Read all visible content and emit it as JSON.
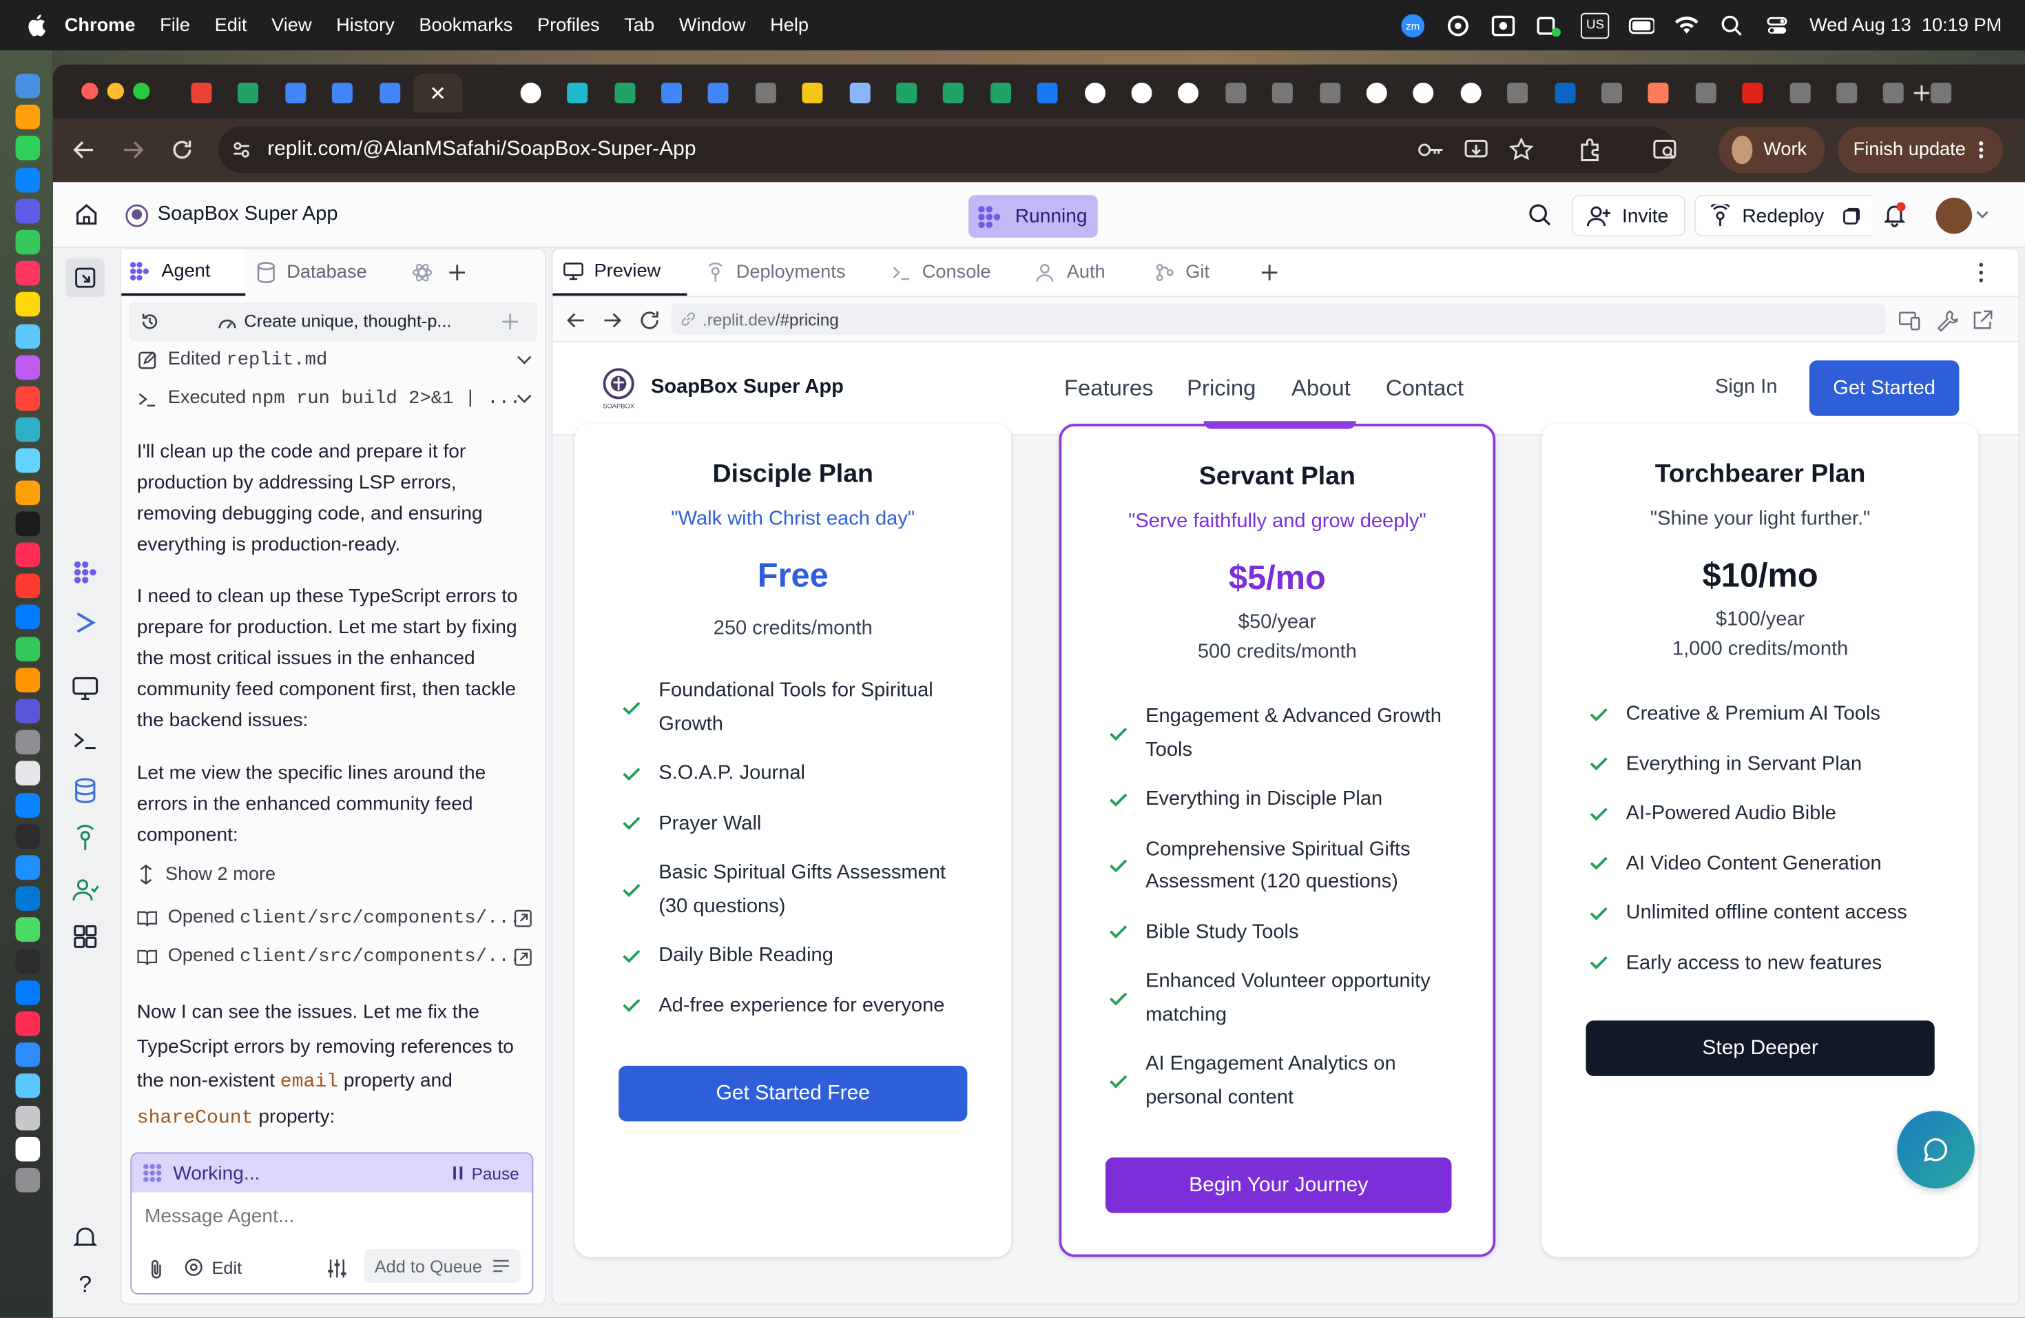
{
  "menubar": {
    "app": "Chrome",
    "menus": [
      "File",
      "Edit",
      "View",
      "History",
      "Bookmarks",
      "Profiles",
      "Tab",
      "Window",
      "Help"
    ],
    "input_source": "US",
    "datetime": "Wed Aug 13  10:19 PM"
  },
  "browser": {
    "url": "replit.com/@AlanMSafahi/SoapBox-Super-App",
    "profile_label": "Work",
    "update_label": "Finish update",
    "tab_icons": [
      "gmail-icon",
      "sheets-icon",
      "docs-icon",
      "docs-icon",
      "docs-icon",
      "replit-icon",
      "chatgpt-icon",
      "perplexity-icon",
      "sheets-icon",
      "docs-icon",
      "docs-icon",
      "app-icon",
      "coin-icon",
      "gemini-icon",
      "sheets-icon",
      "sheets-icon",
      "sheets-icon",
      "facebook-icon",
      "github-icon",
      "google-icon",
      "x-icon",
      "app-icon",
      "app-icon",
      "app-icon",
      "google-icon",
      "google-icon",
      "google-icon",
      "app-icon",
      "linkedin-icon",
      "app-icon",
      "hubspot-icon",
      "app-icon",
      "acrobat-icon",
      "app-icon",
      "app-icon",
      "app-icon",
      "app-icon"
    ]
  },
  "replit": {
    "project_name": "SoapBox Super App",
    "status": "Running",
    "invite_label": "Invite",
    "redeploy_label": "Redeploy",
    "left_tabs": [
      "Agent",
      "Database"
    ],
    "right_tabs": [
      "Preview",
      "Deployments",
      "Console",
      "Auth",
      "Git"
    ],
    "agent": {
      "thread_title": "Create unique, thought-p...",
      "edited_label": "Edited ",
      "edited_file": "replit.md",
      "executed_label": "Executed ",
      "executed_cmd": "npm run build 2>&1 | ...",
      "para1": "I'll clean up the code and prepare it for production by addressing LSP errors, removing debugging code, and ensuring everything is production-ready.",
      "para2": "I need to clean up these TypeScript errors to prepare for production. Let me start by fixing the most critical issues in the enhanced community feed component first, then tackle the backend issues:",
      "para3": "Let me view the specific lines around the errors in the enhanced community feed component:",
      "show_more": "Show 2 more",
      "opened_label": "Opened ",
      "opened_1": "client/src/components/...",
      "opened_2": "client/src/components/...",
      "para4_a": "Now I can see the issues. Let me fix the TypeScript errors by removing references to the non-existent ",
      "para4_code1": "email",
      "para4_b": " property and ",
      "para4_code2": "shareCount",
      "para4_c": " property:",
      "working_label": "Working...",
      "pause_label": "Pause",
      "message_placeholder": "Message Agent...",
      "edit_label": "Edit",
      "queue_label": "Add to Queue"
    },
    "preview": {
      "url_dim": ".replit.dev",
      "url_path": "/#pricing"
    }
  },
  "site": {
    "brand": "SoapBox Super App",
    "logo_text": "SOAPBOX",
    "nav": [
      "Features",
      "Pricing",
      "About",
      "Contact"
    ],
    "sign_in": "Sign In",
    "get_started": "Get Started",
    "plans": [
      {
        "title": "Disciple Plan",
        "tagline": "\"Walk with Christ each day\"",
        "price": "Free",
        "sub1": "250 credits/month",
        "sub2": "",
        "features": [
          "Foundational Tools for Spiritual Growth",
          "S.O.A.P. Journal",
          "Prayer Wall",
          "Basic Spiritual Gifts Assessment (30 questions)",
          "Daily Bible Reading",
          "Ad-free experience for everyone"
        ],
        "button": "Get Started Free",
        "accent": "#2f5fd8"
      },
      {
        "title": "Servant Plan",
        "tagline": "\"Serve faithfully and grow deeply\"",
        "price": "$5/mo",
        "sub1": "$50/year",
        "sub2": "500 credits/month",
        "features": [
          "Engagement & Advanced Growth Tools",
          "Everything in Disciple Plan",
          "Comprehensive Spiritual Gifts Assessment (120 questions)",
          "Bible Study Tools",
          "Enhanced Volunteer opportunity matching",
          "AI Engagement Analytics on personal content"
        ],
        "button": "Begin Your Journey",
        "accent": "#7c2fd8"
      },
      {
        "title": "Torchbearer Plan",
        "tagline": "\"Shine your light further.\"",
        "price": "$10/mo",
        "sub1": "$100/year",
        "sub2": "1,000 credits/month",
        "features": [
          "Creative & Premium AI Tools",
          "Everything in Servant Plan",
          "AI-Powered Audio Bible",
          "AI Video Content Generation",
          "Unlimited offline content access",
          "Early access to new features"
        ],
        "button": "Step Deeper",
        "accent": "#111827"
      }
    ]
  },
  "colors": {
    "check": "#22a05a",
    "primary_blue": "#2f5fd8",
    "primary_purple": "#7c2fd8",
    "replit_running": "#c3b8f5"
  }
}
